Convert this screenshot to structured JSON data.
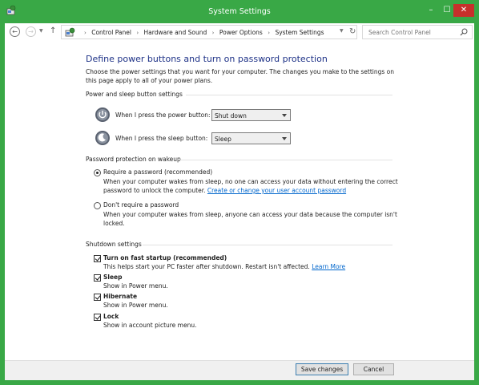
{
  "window": {
    "title": "System Settings",
    "controls": {
      "minimize": "–",
      "maximize": "☐",
      "close": "✕"
    },
    "accent": "#39a846"
  },
  "address": {
    "breadcrumbs": [
      "Control Panel",
      "Hardware and Sound",
      "Power Options",
      "System Settings"
    ],
    "search_placeholder": "Search Control Panel"
  },
  "page": {
    "title": "Define power buttons and turn on password protection",
    "intro": "Choose the power settings that you want for your computer. The changes you make to the settings on this page apply to all of your power plans."
  },
  "power_section": {
    "header": "Power and sleep button settings",
    "rows": [
      {
        "label": "When I press the power button:",
        "value": "Shut down",
        "icon": "power-button-icon"
      },
      {
        "label": "When I press the sleep button:",
        "value": "Sleep",
        "icon": "sleep-button-icon"
      }
    ]
  },
  "password_section": {
    "header": "Password protection on wakeup",
    "options": [
      {
        "label": "Require a password (recommended)",
        "desc": "When your computer wakes from sleep, no one can access your data without entering the correct password to unlock the computer.",
        "link": "Create or change your user account password",
        "checked": true
      },
      {
        "label": "Don't require a password",
        "desc": "When your computer wakes from sleep, anyone can access your data because the computer isn't locked.",
        "checked": false
      }
    ]
  },
  "shutdown_section": {
    "header": "Shutdown settings",
    "items": [
      {
        "label": "Turn on fast startup (recommended)",
        "desc": "This helps start your PC faster after shutdown. Restart isn't affected.",
        "link": "Learn More",
        "checked": true
      },
      {
        "label": "Sleep",
        "desc": "Show in Power menu.",
        "checked": true
      },
      {
        "label": "Hibernate",
        "desc": "Show in Power menu.",
        "checked": true
      },
      {
        "label": "Lock",
        "desc": "Show in account picture menu.",
        "checked": true
      }
    ]
  },
  "footer": {
    "save_label": "Save changes",
    "cancel_label": "Cancel"
  }
}
